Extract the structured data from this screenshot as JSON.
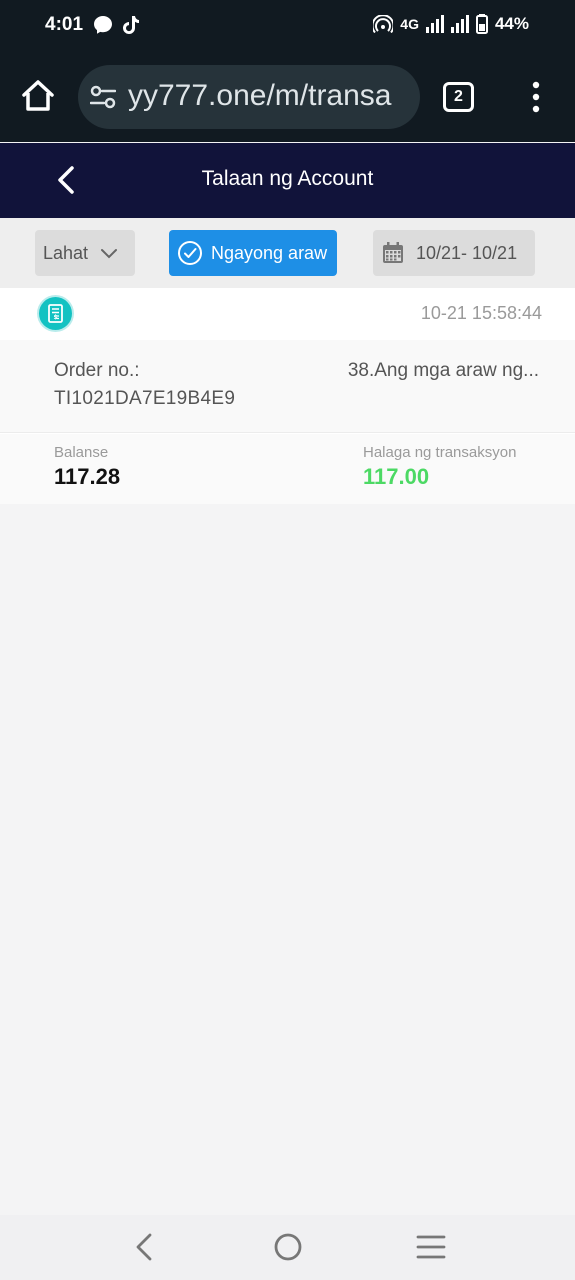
{
  "status_bar": {
    "time": "4:01",
    "network": "4G",
    "battery": "44%",
    "icons": [
      "messenger-icon",
      "tiktok-icon",
      "hotspot-icon",
      "signal-icon",
      "battery-icon"
    ]
  },
  "browser": {
    "url": "yy777.one/m/transa",
    "tab_count": "2"
  },
  "header": {
    "title": "Talaan ng Account"
  },
  "filters": {
    "type_label": "Lahat",
    "today_label": "Ngayong araw",
    "date_range": "10/21- 10/21"
  },
  "record": {
    "datetime": "10-21 15:58:44",
    "order_label": "Order no.:",
    "order_no": "TI1021DA7E19B4E9",
    "description": "38.Ang mga araw ng...",
    "balance_label": "Balanse",
    "balance_value": "117.28",
    "amount_label": "Halaga ng transaksyon",
    "amount_value": "117.00"
  },
  "colors": {
    "header_bg": "#11133a",
    "accent": "#1e8fe6",
    "amount_positive": "#4cd964",
    "record_icon": "#13c2c2"
  }
}
